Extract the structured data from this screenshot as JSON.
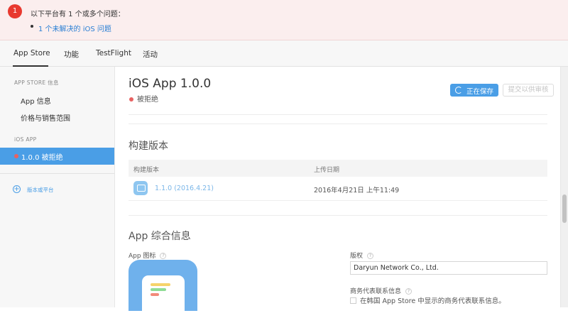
{
  "alert": {
    "badge": "1",
    "message": "以下平台有 1 个或多个问题：",
    "issue_link": "1 个未解决的 iOS 问题",
    "color": "#e8392f"
  },
  "tabs": [
    {
      "label": "App Store",
      "active": true
    },
    {
      "label": "功能",
      "active": false
    },
    {
      "label": "TestFlight",
      "active": false
    },
    {
      "label": "活动",
      "active": false
    }
  ],
  "sidebar": {
    "section_app_store": "APP STORE 信息",
    "items": [
      {
        "label": "App 信息"
      },
      {
        "label": "价格与销售范围"
      }
    ],
    "section_ios": "iOS APP",
    "active_version": "1.0.0 被拒绝",
    "add_platform": "版本或平台",
    "accent": "#4a9ee6"
  },
  "main": {
    "version_title": "iOS App 1.0.0",
    "status": "被拒绝",
    "status_color": "#e86262",
    "saving_button": "正在保存",
    "submit_button": "提交以供审核",
    "build_section_title": "构建版本",
    "build_table": {
      "headers": [
        "构建版本",
        "上传日期"
      ],
      "rows": [
        {
          "build": "1.1.0 (2016.4.21)",
          "date": "2016年4月21日 上午11:49",
          "icon": "chat-bubble-icon"
        }
      ]
    },
    "general_section_title": "App 综合信息",
    "app_icon_label": "App 图标",
    "help_glyph": "?",
    "copyright_label": "版权",
    "copyright_value": "Daryun Network Co., Ltd.",
    "trade_rep_label": "商务代表联系信息",
    "trade_rep_checkbox": "在韩国 App Store 中显示的商务代表联系信息。"
  }
}
